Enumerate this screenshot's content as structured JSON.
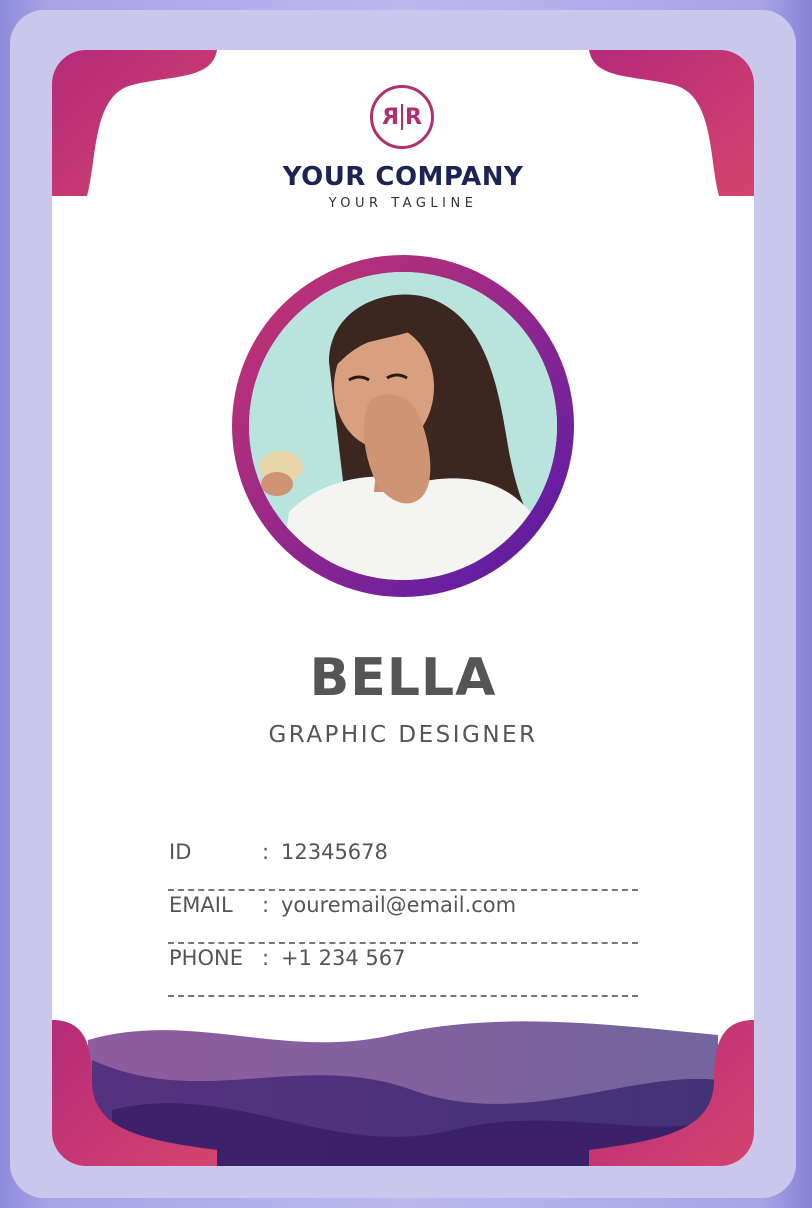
{
  "company": {
    "logo_mark": "R",
    "name": "YOUR COMPANY",
    "tagline": "YOUR TAGLINE"
  },
  "person": {
    "name": "BELLA",
    "title": "GRAPHIC DESIGNER"
  },
  "details": [
    {
      "label": "ID",
      "separator": ":",
      "value": "12345678"
    },
    {
      "label": "EMAIL",
      "separator": ":",
      "value": "youremail@email.com"
    },
    {
      "label": "PHONE",
      "separator": ":",
      "value": "+1 234 567"
    }
  ],
  "colors": {
    "brand_navy": "#1c2456",
    "accent_magenta": "#c8366f",
    "accent_purple": "#4c1c8e",
    "text_gray": "#555555"
  }
}
